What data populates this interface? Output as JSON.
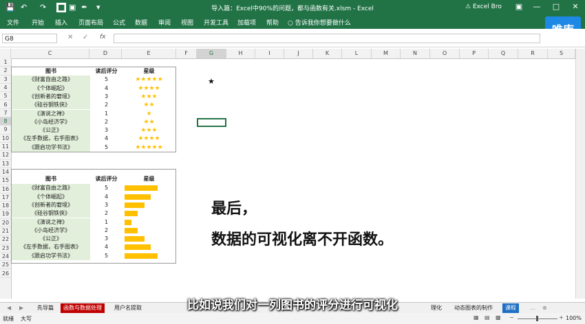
{
  "titlebar": {
    "title": "导入篇：Excel中90%的问题，都与函数有关.xlsm - Excel",
    "account": "Excel Bro"
  },
  "ribbon": {
    "tabs": [
      "文件",
      "开始",
      "插入",
      "页面布局",
      "公式",
      "数据",
      "审阅",
      "视图",
      "开发工具",
      "加载项",
      "帮助"
    ],
    "tell_me": "告诉我你想要做什么",
    "logo": "唯库"
  },
  "formula": {
    "namebox": "G8",
    "fx": "fx"
  },
  "columns": [
    "C",
    "D",
    "E",
    "F",
    "G",
    "H",
    "I",
    "J",
    "K",
    "L",
    "M",
    "N",
    "O",
    "P",
    "Q",
    "R",
    "S"
  ],
  "rows": [
    "1",
    "2",
    "3",
    "4",
    "5",
    "6",
    "7",
    "8",
    "9",
    "10",
    "11",
    "12",
    "13",
    "14",
    "15",
    "16",
    "17",
    "18",
    "19",
    "20",
    "21",
    "22",
    "23",
    "24",
    "25",
    "26"
  ],
  "table1": {
    "headers": [
      "图书",
      "读后评分",
      "星级"
    ],
    "rows": [
      {
        "book": "《财富自由之路》",
        "score": "5",
        "stars": "★★★★★"
      },
      {
        "book": "《个体崛起》",
        "score": "4",
        "stars": "★★★★"
      },
      {
        "book": "《创新者的窘境》",
        "score": "3",
        "stars": "★★★"
      },
      {
        "book": "《硅谷钢铁侠》",
        "score": "2",
        "stars": "★★"
      },
      {
        "book": "《演说之禅》",
        "score": "1",
        "stars": "★"
      },
      {
        "book": "《小岛经济学》",
        "score": "2",
        "stars": "★★"
      },
      {
        "book": "《公正》",
        "score": "3",
        "stars": "★★★"
      },
      {
        "book": "《左手数据，右手图表》",
        "score": "4",
        "stars": "★★★★"
      },
      {
        "book": "《跟启功学书法》",
        "score": "5",
        "stars": "★★★★★"
      }
    ]
  },
  "table2": {
    "headers": [
      "图书",
      "读后评分",
      "星级"
    ],
    "rows": [
      {
        "book": "《财富自由之路》",
        "score": "5",
        "value": 5
      },
      {
        "book": "《个体崛起》",
        "score": "4",
        "value": 4
      },
      {
        "book": "《创新者的窘境》",
        "score": "3",
        "value": 3
      },
      {
        "book": "《硅谷钢铁侠》",
        "score": "2",
        "value": 2
      },
      {
        "book": "《演说之禅》",
        "score": "1",
        "value": 1
      },
      {
        "book": "《小岛经济学》",
        "score": "2",
        "value": 2
      },
      {
        "book": "《公正》",
        "score": "3",
        "value": 3
      },
      {
        "book": "《左手数据，右手图表》",
        "score": "4",
        "value": 4
      },
      {
        "book": "《跟启功学书法》",
        "score": "5",
        "value": 5
      }
    ],
    "max": 5
  },
  "overlay": {
    "line1": "最后，",
    "line2": "数据的可视化离不开函数。",
    "star": "★",
    "subtitle": "比如说我们对一列图书的评分进行可视化"
  },
  "sheet_tabs": [
    "先导篇",
    "函数与数据处理",
    "用户名提取",
    "理化",
    "动态图表的制作",
    "课程"
  ],
  "status": {
    "mode": "就绪",
    "caps": "大写",
    "zoom": "100%"
  },
  "colors": {
    "excel_green": "#217346",
    "bar": "#ffc000",
    "cell_green": "#e2efda"
  }
}
